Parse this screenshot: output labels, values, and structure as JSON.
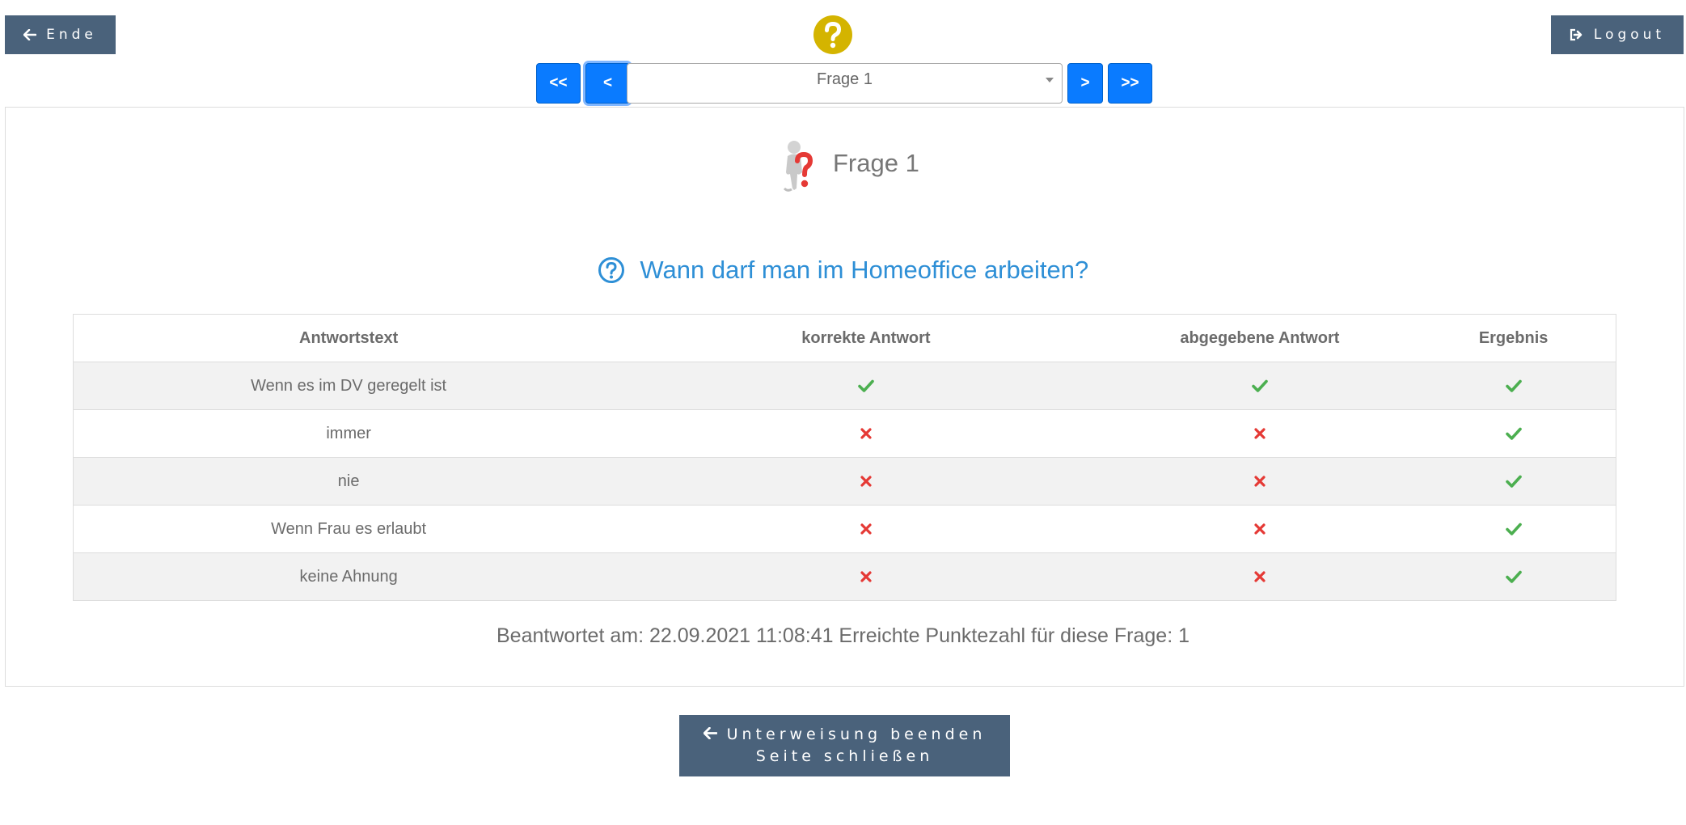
{
  "header": {
    "end_label": "Ende",
    "logout_label": "Logout"
  },
  "nav": {
    "first_label": "<<",
    "prev_label": "<",
    "next_label": ">",
    "last_label": ">>",
    "selected_question": "Frage 1"
  },
  "card": {
    "heading": "Frage 1",
    "question": "Wann darf man im Homeoffice arbeiten?",
    "columns": [
      "Antwortstext",
      "korrekte Antwort",
      "abgegebene Antwort",
      "Ergebnis"
    ],
    "rows": [
      {
        "text": "Wenn es im DV geregelt ist",
        "correct": "check",
        "given": "check",
        "result": "check"
      },
      {
        "text": "immer",
        "correct": "cross",
        "given": "cross",
        "result": "check"
      },
      {
        "text": "nie",
        "correct": "cross",
        "given": "cross",
        "result": "check"
      },
      {
        "text": "Wenn Frau es erlaubt",
        "correct": "cross",
        "given": "cross",
        "result": "check"
      },
      {
        "text": "keine Ahnung",
        "correct": "cross",
        "given": "cross",
        "result": "check"
      }
    ],
    "summary": "Beantwortet am: 22.09.2021 11:08:41 Erreichte Punktezahl für diese Frage: 1"
  },
  "footer": {
    "finish_line1": "Unterweisung beenden",
    "finish_line2": "Seite schließen"
  },
  "colors": {
    "button_dark": "#4a627b",
    "button_blue": "#0a7bff",
    "question_blue": "#2e8fd6",
    "check_green": "#4caf50",
    "cross_red": "#e53935",
    "help_yellow": "#d4b400"
  },
  "icons": {
    "check": "check-icon",
    "cross": "cross-icon"
  }
}
